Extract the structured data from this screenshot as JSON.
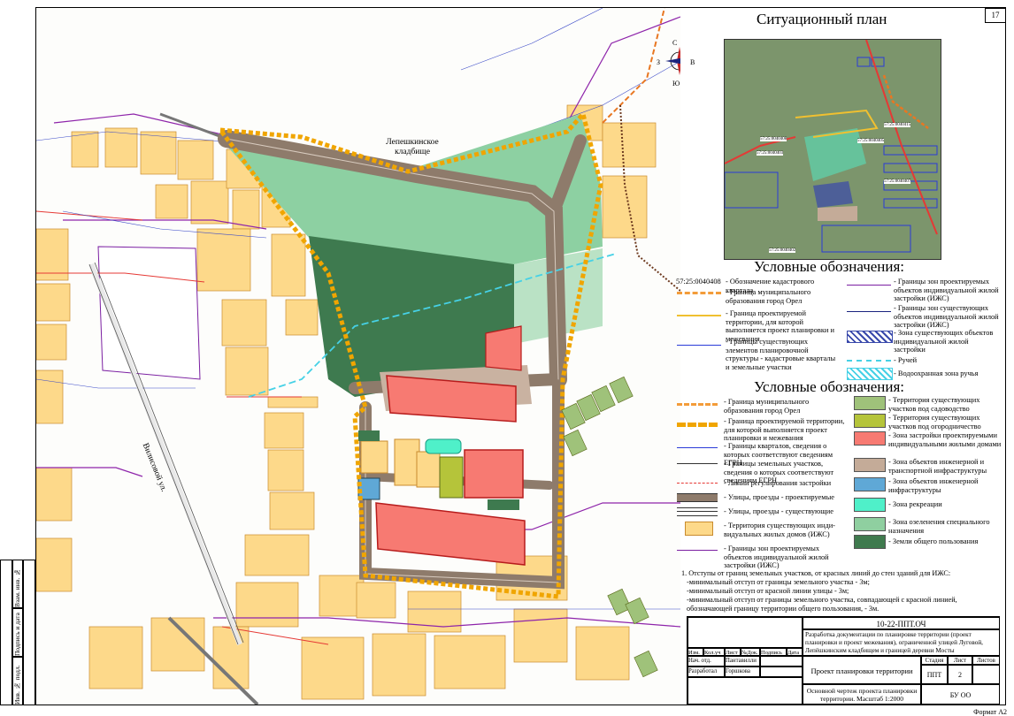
{
  "page_number": "17",
  "map_labels": {
    "cemetery": "Лепешкинское кладбище",
    "street": "Вилисовой ул."
  },
  "compass": {
    "n": "С",
    "s": "Ю",
    "w": "З",
    "e": "В"
  },
  "situational_plan": {
    "title": "Ситуационный план",
    "labels": [
      "57:25:0040408",
      "57:25:0040415",
      "57:25:0040405",
      "57:25:0040403",
      "57:25:0040407",
      "57:25:0040402"
    ]
  },
  "legend1": {
    "title": "Условные обозначения:",
    "left": [
      {
        "code": "57:25:0040408",
        "text": "- Обозначение кадастрового квартала"
      },
      {
        "text": "- Граница муниципального образования город Орел",
        "color": "#f39c3a"
      },
      {
        "text": "- Граница проектируемой территории, для которой выполняется проект планировки и межевания",
        "color": "#f0c030"
      },
      {
        "text": "- Границы существующих элементов планировочной структуры - кадастровые кварталы и земельные участки",
        "color": "#2a3bd8"
      }
    ],
    "right": [
      {
        "text": "- Границы зон проектируемых объектов индивидуальной жилой застройки (ИЖС)",
        "color": "#7b1fa2"
      },
      {
        "text": "- Границы зон существующих объектов индивидуальной жилой застройки (ИЖС)",
        "color": "#1a237e"
      },
      {
        "text": "- Зона существующих объектов индивидуальной жилой застройки",
        "color": "#3949ab"
      },
      {
        "text": "- Ручей",
        "color": "#46d1e6"
      },
      {
        "text": "- Водоохранная зона ручья",
        "color": "#46d1e6"
      }
    ]
  },
  "legend2": {
    "title": "Условные обозначения:",
    "left": [
      "- Граница муниципального образования город Орел",
      "- Граница проектируемой территории, для которой выполняется проект планировки и межевания",
      "- Границы кварталов, сведения о которых соответствуют сведениям ЕГРН",
      "- Границы земельных участков, сведения о которых соответствуют сведениям ЕГРН",
      "- Линии регулирования застройки",
      "- Улицы, проезды - проектируемые",
      "- Улицы, проезды - существующие",
      "- Территория существующих инди-видуальных жилых домов (ИЖС)",
      "- Границы зон проектируемых объектов индивидуальной жилой застройки (ИЖС)"
    ],
    "right": [
      {
        "text": "- Территория существующих участков под садоводство",
        "color": "#9fc27a"
      },
      {
        "text": "- Территория существующих участков под огородничество",
        "color": "#b5c43a"
      },
      {
        "text": "- Зона застройки проектируемыми индивидуальными жилыми домами",
        "color": "#f77a72"
      },
      {
        "text": "- Зона объектов инженерной и транспортной инфраструктуры",
        "color": "#c4ab98"
      },
      {
        "text": "- Зона объектов инженерной инфраструктуры",
        "color": "#5fa8d6"
      },
      {
        "text": "- Зона рекреации",
        "color": "#4ff0c9"
      },
      {
        "text": "- Зона озеленения специального назначения",
        "color": "#8fcfa0"
      },
      {
        "text": "- Земли общего пользования",
        "color": "#3f7a4e"
      }
    ]
  },
  "notes": {
    "heading": "1. Отступы от границ земельных участков, от красных линий до стен зданий для ИЖС:",
    "lines": [
      "-минимальный отступ от границы земельного участка - 3м;",
      "-минимальный отступ от красной линии улицы - 3м;",
      "-минимальный отступ от границы земельного участка, совпадающей с красной линией, обозначающей границу территории общего пользования, - 3м."
    ]
  },
  "stamp": {
    "code": "10-22-ППТ.ОЧ",
    "description": "Разработка документации по планировке территории (проект планировки и проект межевания), ограниченной улицей Луговой, Лепёшкинским кладбищем и границей деревни Мосты",
    "headers": [
      "Изм.",
      "Кол.уч",
      "Лист",
      "№Док.",
      "Подпись",
      "Дата"
    ],
    "role1": "Нач. отд.",
    "name1": "Пантавилли",
    "role2": "Разработал",
    "name2": "Горшкова",
    "project": "Проект планировки территории",
    "drawing": "Основной чертеж проекта планировки территории. Масштаб 1:2000",
    "stage_h": "Стадия",
    "sheet_h": "Лист",
    "sheets_h": "Листов",
    "stage": "ППТ",
    "sheet": "2",
    "sheets": "",
    "org": "БУ ОО \"ОРЕЛАРХПЛАН\""
  },
  "side_stamp": [
    "Взам. инв. №",
    "Подпись и дата",
    "Инв. № подл."
  ],
  "format": "Формат А2"
}
